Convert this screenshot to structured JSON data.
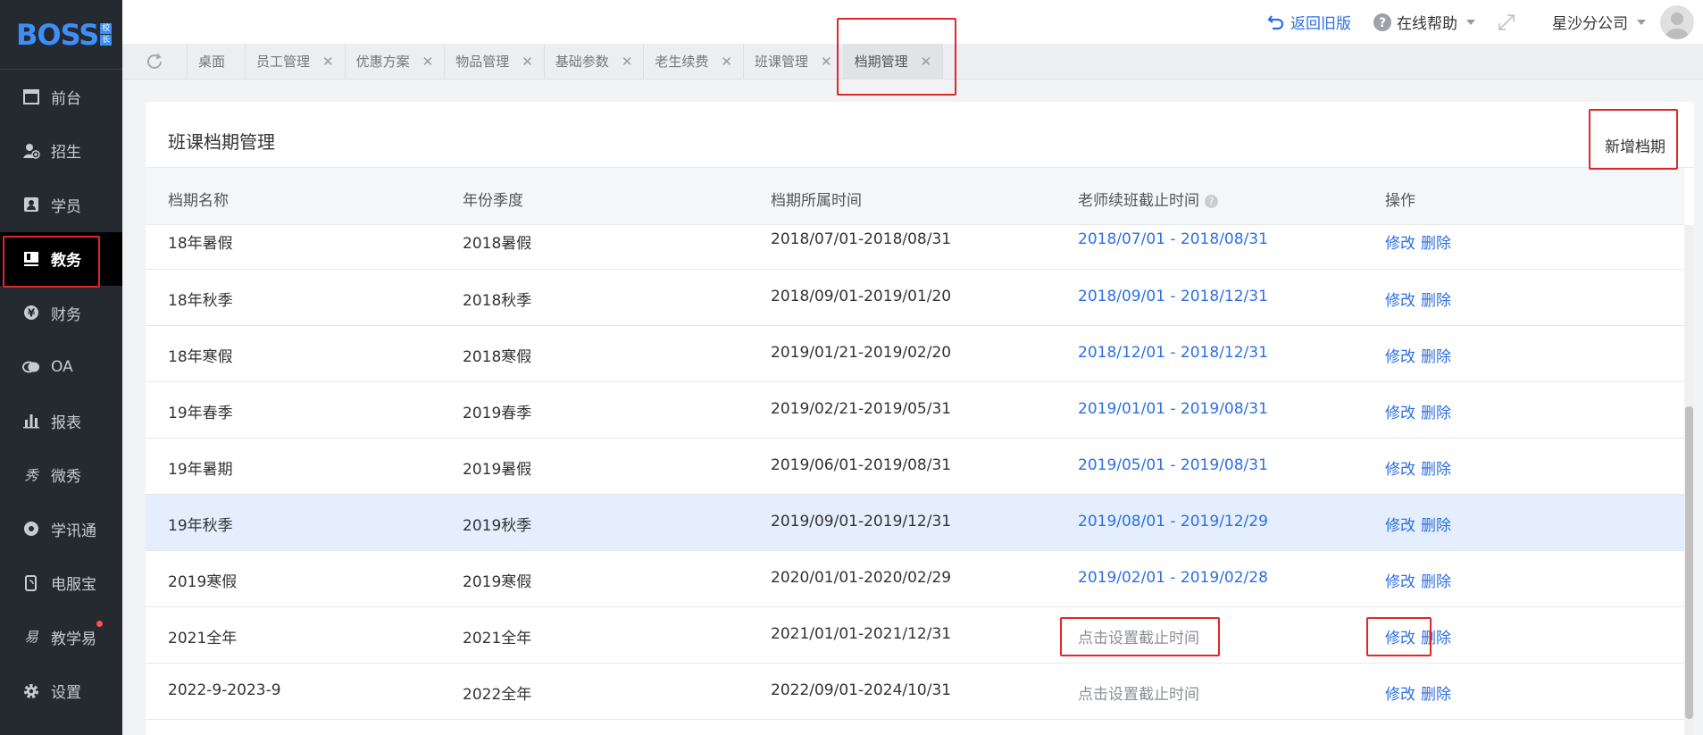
{
  "sidebar": {
    "logo": "BOSS",
    "logo_badge": [
      "校",
      "长"
    ],
    "items": [
      {
        "label": "前台",
        "icon": "calendar-icon",
        "active": false
      },
      {
        "label": "招生",
        "icon": "user-add-icon",
        "active": false
      },
      {
        "label": "学员",
        "icon": "student-icon",
        "active": false
      },
      {
        "label": "教务",
        "icon": "book-icon",
        "active": true
      },
      {
        "label": "财务",
        "icon": "yen-icon",
        "active": false
      },
      {
        "label": "OA",
        "icon": "chat-icon",
        "active": false
      },
      {
        "label": "报表",
        "icon": "bar-chart-icon",
        "active": false
      },
      {
        "label": "微秀",
        "icon": "xiu-icon",
        "active": false
      },
      {
        "label": "学讯通",
        "icon": "location-icon",
        "active": false
      },
      {
        "label": "电服宝",
        "icon": "phone-icon",
        "active": false
      },
      {
        "label": "教学易",
        "icon": "yi-icon",
        "active": false,
        "dot": true
      },
      {
        "label": "设置",
        "icon": "gear-icon",
        "active": false
      }
    ]
  },
  "topbar": {
    "back_label": "返回旧版",
    "help_label": "在线帮助",
    "branch_label": "星沙分公司"
  },
  "tabs": [
    {
      "label": "桌面",
      "closable": false,
      "active": false
    },
    {
      "label": "员工管理",
      "closable": true,
      "active": false
    },
    {
      "label": "优惠方案",
      "closable": true,
      "active": false
    },
    {
      "label": "物品管理",
      "closable": true,
      "active": false
    },
    {
      "label": "基础参数",
      "closable": true,
      "active": false
    },
    {
      "label": "老生续费",
      "closable": true,
      "active": false
    },
    {
      "label": "班课管理",
      "closable": true,
      "active": false
    },
    {
      "label": "档期管理",
      "closable": true,
      "active": true
    }
  ],
  "panel": {
    "title": "班课档期管理",
    "add_button": "新增档期"
  },
  "table": {
    "headers": [
      "档期名称",
      "年份季度",
      "档期所属时间",
      "老师续班截止时间",
      "操作"
    ],
    "edit_label": "修改",
    "delete_label": "删除",
    "rows": [
      {
        "name": "18年暑假",
        "season": "2018暑假",
        "period": "2018/07/01-2018/08/31",
        "deadline": "2018/07/01 - 2018/08/31",
        "deadline_set": true
      },
      {
        "name": "18年秋季",
        "season": "2018秋季",
        "period": "2018/09/01-2019/01/20",
        "deadline": "2018/09/01 - 2018/12/31",
        "deadline_set": true
      },
      {
        "name": "18年寒假",
        "season": "2018寒假",
        "period": "2019/01/21-2019/02/20",
        "deadline": "2018/12/01 - 2018/12/31",
        "deadline_set": true
      },
      {
        "name": "19年春季",
        "season": "2019春季",
        "period": "2019/02/21-2019/05/31",
        "deadline": "2019/01/01 - 2019/08/31",
        "deadline_set": true
      },
      {
        "name": "19年暑期",
        "season": "2019暑假",
        "period": "2019/06/01-2019/08/31",
        "deadline": "2019/05/01 - 2019/08/31",
        "deadline_set": true
      },
      {
        "name": "19年秋季",
        "season": "2019秋季",
        "period": "2019/09/01-2019/12/31",
        "deadline": "2019/08/01 - 2019/12/29",
        "deadline_set": true,
        "highlight": true
      },
      {
        "name": "2019寒假",
        "season": "2019寒假",
        "period": "2020/01/01-2020/02/29",
        "deadline": "2019/02/01 - 2019/02/28",
        "deadline_set": true
      },
      {
        "name": "2021全年",
        "season": "2021全年",
        "period": "2021/01/01-2021/12/31",
        "deadline": "点击设置截止时间",
        "deadline_set": false
      },
      {
        "name": "2022-9-2023-9",
        "season": "2022全年",
        "period": "2022/09/01-2024/10/31",
        "deadline": "点击设置截止时间",
        "deadline_set": false
      }
    ]
  },
  "colors": {
    "sidebar_bg": "#252a31",
    "accent_blue": "#2d6fe5",
    "highlight_row": "#e4eefc",
    "annotation_red": "#e0272b"
  }
}
